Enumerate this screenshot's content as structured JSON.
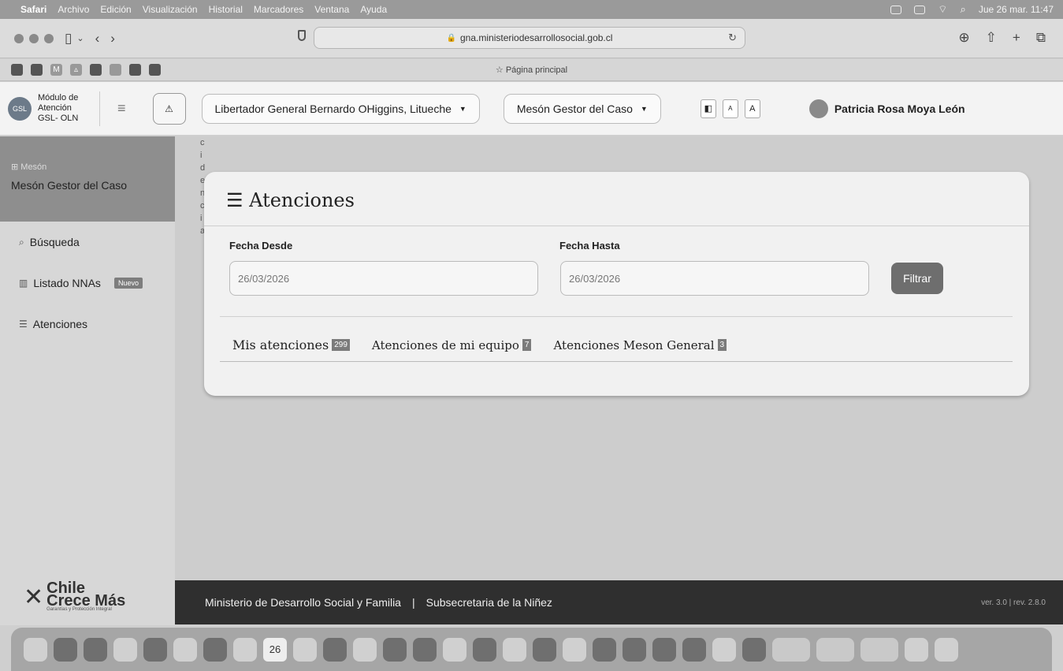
{
  "menubar": {
    "app": "Safari",
    "items": [
      "Archivo",
      "Edición",
      "Visualización",
      "Historial",
      "Marcadores",
      "Ventana",
      "Ayuda"
    ],
    "datetime": "Jue 26 mar. 11:47"
  },
  "browser": {
    "url": "gna.ministeriodesarrollosocial.gob.cl",
    "favorites_center": "Página principal"
  },
  "header": {
    "module_title": "Módulo de Atención GSL- OLN",
    "location_select": "Libertador General Bernardo OHiggins, Litueche",
    "desk_select": "Mesón Gestor del Caso",
    "user_name": "Patricia Rosa Moya León",
    "font_a1": "A",
    "font_a2": "A"
  },
  "sidebar": {
    "section_sub": "Mesón",
    "section_main": "Mesón Gestor del Caso",
    "items": [
      {
        "label": "Búsqueda",
        "icon": "search-icon"
      },
      {
        "label": "Listado NNAs",
        "icon": "trash-icon",
        "badge": "Nuevo"
      },
      {
        "label": "Atenciones",
        "icon": "list-icon"
      }
    ],
    "brand_line1": "Chile",
    "brand_line2": "Crece Más",
    "brand_tagline": "Garantías y Protección Integral"
  },
  "main": {
    "title": "Atenciones",
    "fecha_desde_label": "Fecha Desde",
    "fecha_desde_value": "26/03/2026",
    "fecha_hasta_label": "Fecha Hasta",
    "fecha_hasta_value": "26/03/2026",
    "filter_button": "Filtrar",
    "tabs": [
      {
        "label": "Mis atenciones",
        "count": "299"
      },
      {
        "label": "Atenciones de mi equipo",
        "count": "7"
      },
      {
        "label": "Atenciones Meson General",
        "count": "3"
      }
    ]
  },
  "footer": {
    "ministry": "Ministerio de Desarrollo Social y Familia",
    "separator": "|",
    "subsecretaria": "Subsecretaria de la Niñez",
    "version": "ver. 3.0 | rev. 2.8.0"
  },
  "dock": {
    "calendar_day": "26"
  }
}
